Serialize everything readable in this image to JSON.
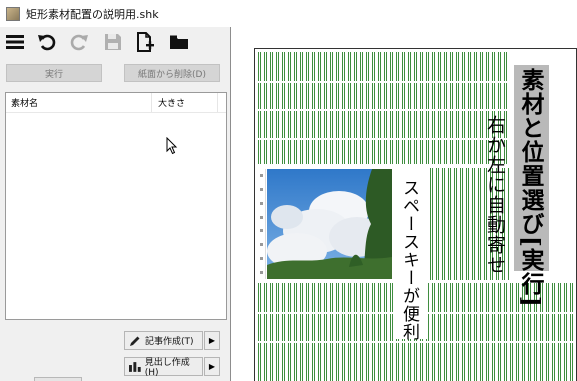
{
  "window": {
    "title": "矩形素材配置の説明用.shk"
  },
  "toolbar": {
    "icons": [
      "menu-icon",
      "undo-icon",
      "redo-icon",
      "save-icon",
      "new-document-icon",
      "folder-icon"
    ]
  },
  "buttons": {
    "execute": "実行",
    "remove_from_page": "紙面から削除(D)"
  },
  "material_list": {
    "columns": [
      "素材名",
      "大きさ"
    ],
    "rows": []
  },
  "actions": {
    "create_article": "記事作成(T)",
    "create_headline": "見出し作成(H)"
  },
  "layout_page": {
    "headline": "素材と位置選び[実行]",
    "subheadline": "右か左に自動寄せ",
    "body": "スペースキーが便利"
  }
}
